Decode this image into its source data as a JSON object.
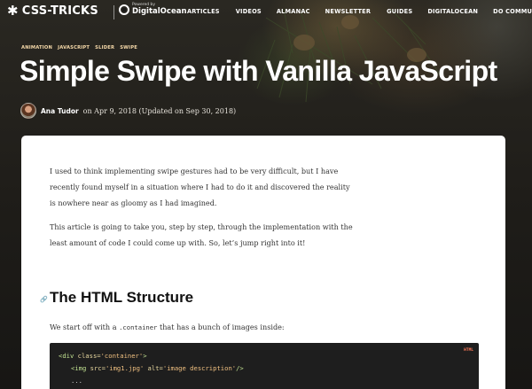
{
  "header": {
    "logo_star": "✱",
    "logo_text": "CSS-TRICKS",
    "sponsor_small": "Powered by",
    "sponsor_name": "DigitalOcean",
    "nav": [
      "ARTICLES",
      "VIDEOS",
      "ALMANAC",
      "NEWSLETTER",
      "GUIDES",
      "DIGITALOCEAN",
      "DO COMMUNITY"
    ]
  },
  "post": {
    "tags": [
      "ANIMATION",
      "JAVASCRIPT",
      "SLIDER",
      "SWIPE"
    ],
    "title": "Simple Swipe with Vanilla JavaScript",
    "author": "Ana Tudor",
    "date_text": "on Apr 9, 2018 (Updated on Sep 30, 2018)"
  },
  "article": {
    "p1_line1": "I used to think implementing swipe gestures had to be very difficult, but I have",
    "p1_line2": "recently found myself in a situation where I had to do it and discovered the reality",
    "p1_line3": "is nowhere near as gloomy as I had imagined.",
    "p2_line1": "This article is going to take you, step by step, through the implementation with the",
    "p2_line2": "least amount of code I could come up with. So, let’s jump right into it!",
    "link_icon": "🔗",
    "h2": "The HTML Structure",
    "p3_before": "We start off with a ",
    "p3_code": ".container",
    "p3_after": " that has a bunch of images inside:",
    "code_lang": "HTML",
    "code_line1_open": "<div ",
    "code_line1_attr": "class=",
    "code_line1_val": "'container'",
    "code_line1_close": ">",
    "code_line2_open": "<img ",
    "code_line2_attr1": "src=",
    "code_line2_val1": "'img1.jpg'",
    "code_line2_attr2": " alt=",
    "code_line2_val2": "'image description'",
    "code_line2_close": "/>",
    "code_line3": "..."
  },
  "colors": {
    "tag": "#f5d8a8",
    "code_bg": "#1e1e1e",
    "code_lang": "#ff7a59"
  }
}
